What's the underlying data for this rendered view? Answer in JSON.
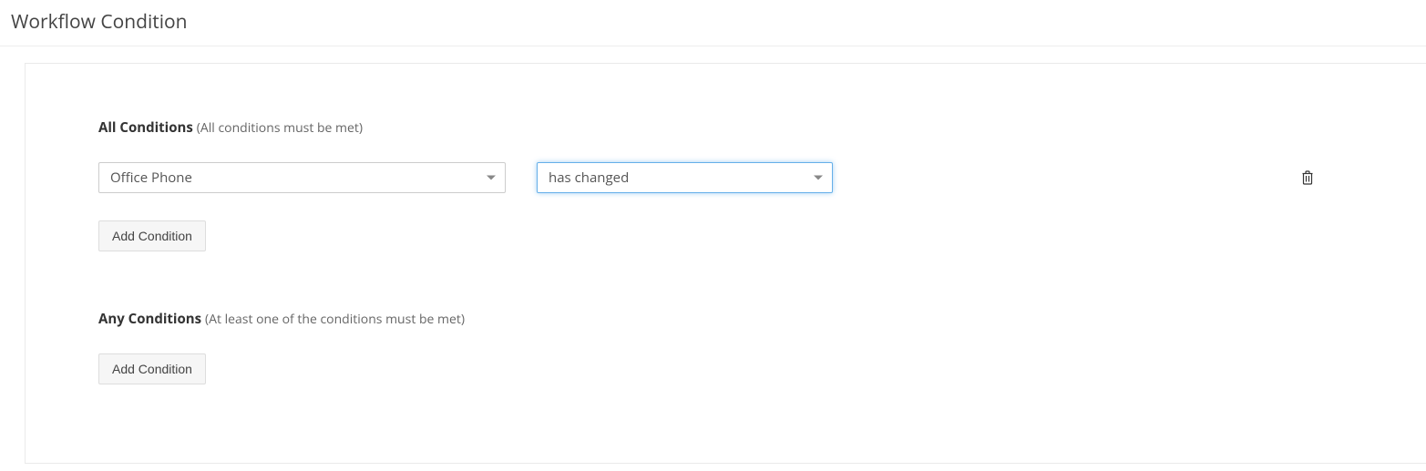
{
  "header": {
    "title": "Workflow Condition"
  },
  "sections": {
    "all": {
      "title": "All Conditions",
      "hint": "(All conditions must be met)",
      "add_button": "Add Condition",
      "condition": {
        "field": "Office Phone",
        "operator": "has changed"
      }
    },
    "any": {
      "title": "Any Conditions",
      "hint": "(At least one of the conditions must be met)",
      "add_button": "Add Condition"
    }
  }
}
